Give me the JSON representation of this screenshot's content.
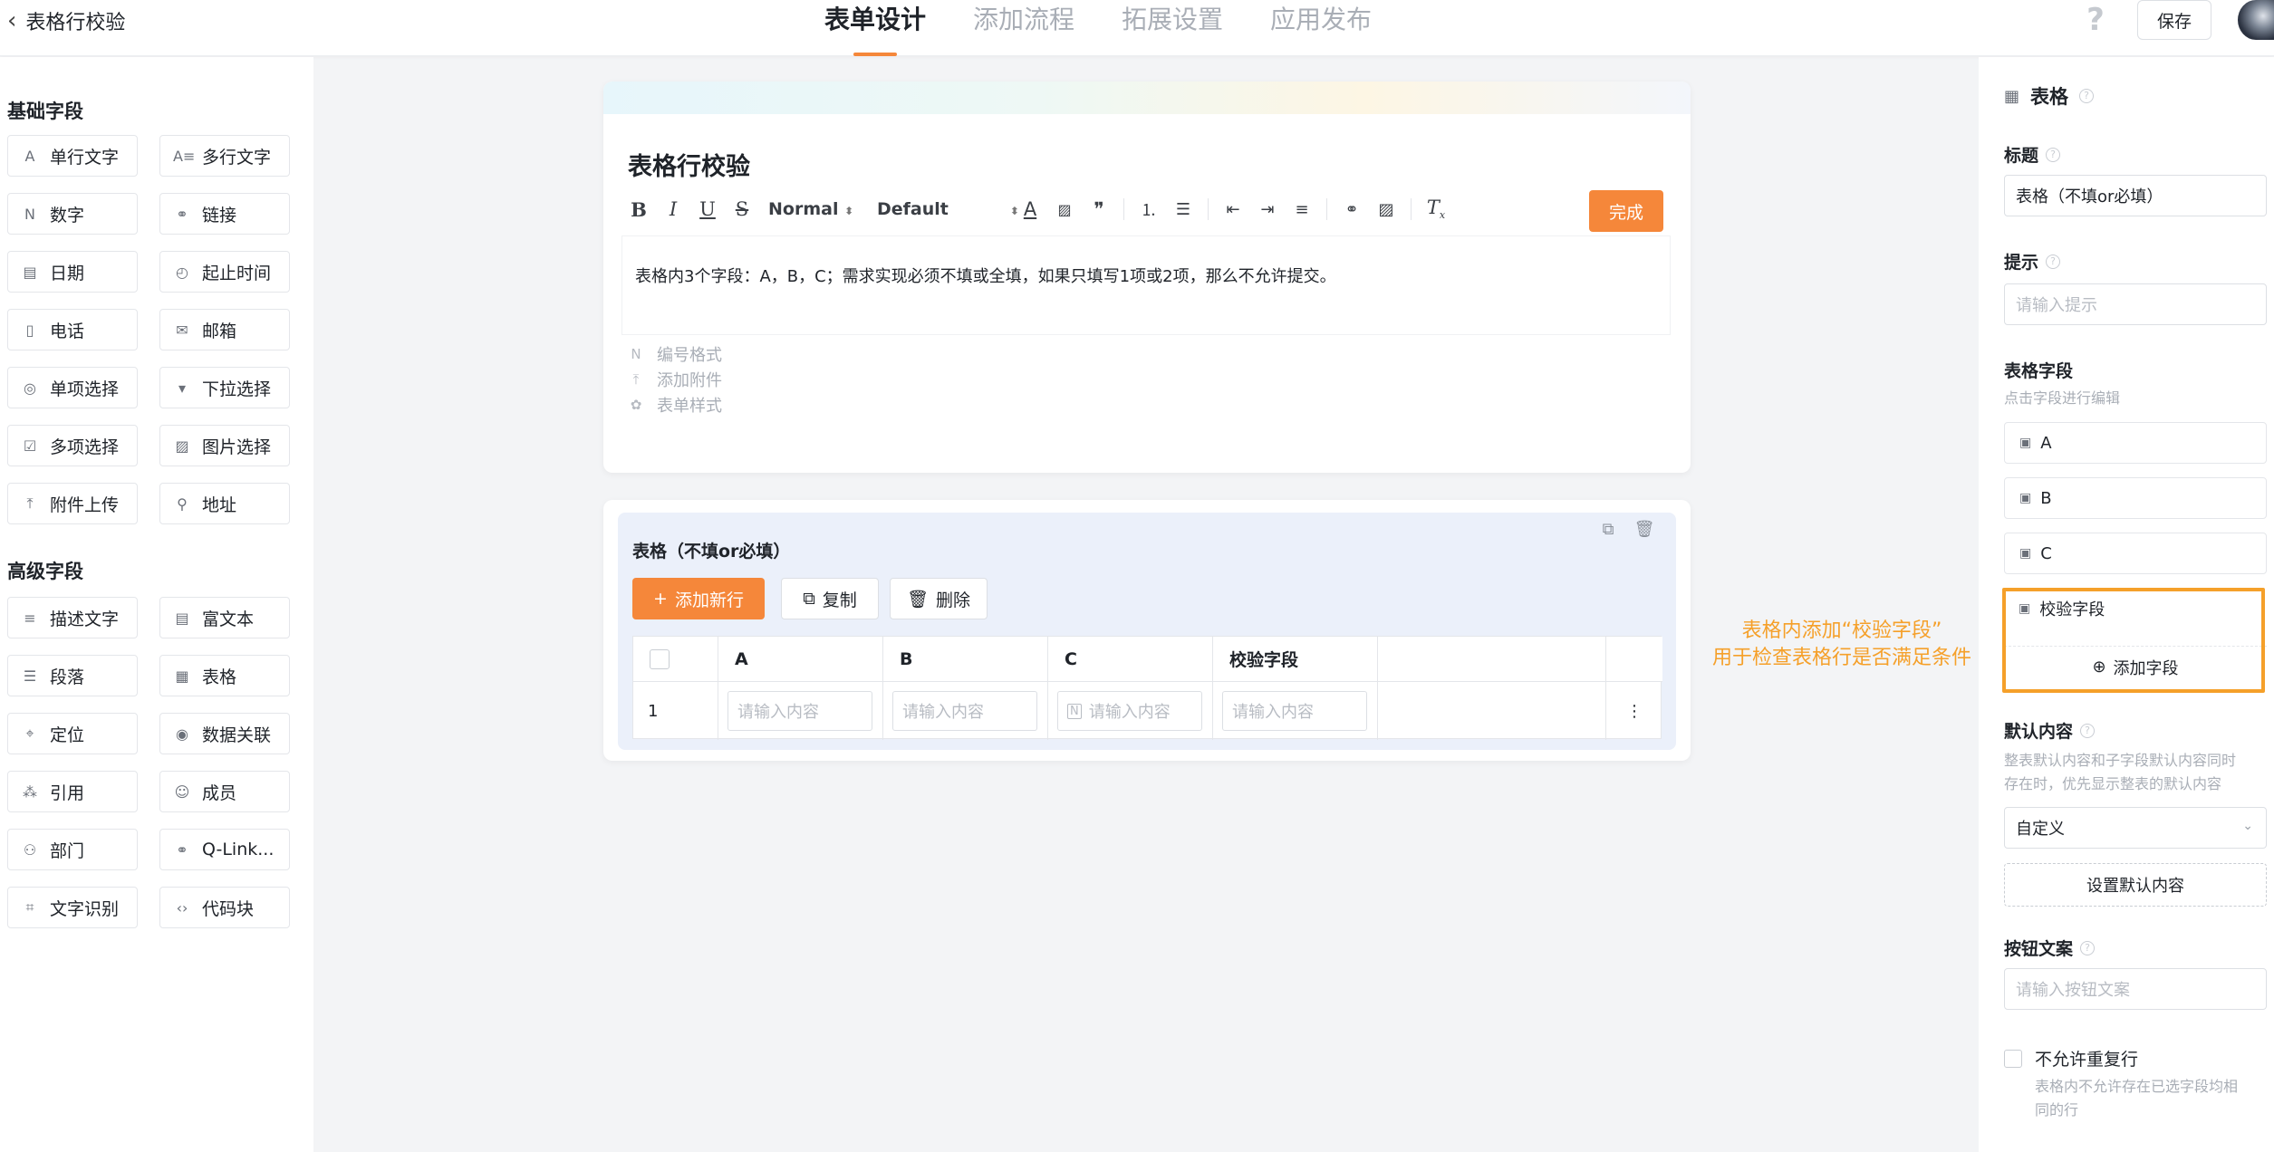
{
  "header": {
    "back_label": "表格行校验",
    "tabs": [
      {
        "label": "表单设计",
        "active": true
      },
      {
        "label": "添加流程",
        "active": false
      },
      {
        "label": "拓展设置",
        "active": false
      },
      {
        "label": "应用发布",
        "active": false
      }
    ],
    "help": "?",
    "save_label": "保存"
  },
  "sidebar": {
    "basic_title": "基础字段",
    "basic": [
      {
        "label": "单行文字",
        "icon": "A"
      },
      {
        "label": "多行文字",
        "icon": "A≡"
      },
      {
        "label": "数字",
        "icon": "N"
      },
      {
        "label": "链接",
        "icon": "⚭"
      },
      {
        "label": "日期",
        "icon": "▤"
      },
      {
        "label": "起止时间",
        "icon": "◴"
      },
      {
        "label": "电话",
        "icon": "▯"
      },
      {
        "label": "邮箱",
        "icon": "✉"
      },
      {
        "label": "单项选择",
        "icon": "◎"
      },
      {
        "label": "下拉选择",
        "icon": "▾"
      },
      {
        "label": "多项选择",
        "icon": "☑"
      },
      {
        "label": "图片选择",
        "icon": "▨"
      },
      {
        "label": "附件上传",
        "icon": "⤒"
      },
      {
        "label": "地址",
        "icon": "⚲"
      }
    ],
    "advanced_title": "高级字段",
    "advanced": [
      {
        "label": "描述文字",
        "icon": "≡"
      },
      {
        "label": "富文本",
        "icon": "▤"
      },
      {
        "label": "段落",
        "icon": "☰"
      },
      {
        "label": "表格",
        "icon": "▦"
      },
      {
        "label": "定位",
        "icon": "⌖"
      },
      {
        "label": "数据关联",
        "icon": "◉"
      },
      {
        "label": "引用",
        "icon": "⁂"
      },
      {
        "label": "成员",
        "icon": "☺"
      },
      {
        "label": "部门",
        "icon": "⚇"
      },
      {
        "label": "Q-Link...",
        "icon": "⚭"
      },
      {
        "label": "文字识别",
        "icon": "⌗"
      },
      {
        "label": "代码块",
        "icon": "‹›"
      }
    ]
  },
  "form": {
    "title": "表格行校验",
    "toolbar": {
      "bold": "B",
      "italic": "I",
      "underline": "U",
      "strike": "S",
      "heading": "Normal",
      "font": "Default",
      "done_label": "完成"
    },
    "description": "表格内3个字段：A，B，C；需求实现必须不填或全填，如果只填写1项或2项，那么不允许提交。",
    "options": [
      "编号格式",
      "添加附件",
      "表单样式"
    ]
  },
  "table_widget": {
    "title": "表格（不填or必填）",
    "add_row_label": "添加新行",
    "copy_label": "复制",
    "delete_label": "删除",
    "columns": [
      "A",
      "B",
      "C",
      "校验字段"
    ],
    "rows": [
      {
        "index": "1"
      }
    ],
    "cell_placeholder": "请输入内容",
    "more_icon": "⋮"
  },
  "annotation": {
    "line1": "表格内添加“校验字段”",
    "line2": "用于检查表格行是否满足条件",
    "color": "#f5a02a"
  },
  "panel": {
    "title": "表格",
    "title_label": "标题",
    "title_value": "表格（不填or必填）",
    "hint_label": "提示",
    "hint_placeholder": "请输入提示",
    "fields_label": "表格字段",
    "fields_hint": "点击字段进行编辑",
    "fields": [
      "A",
      "B",
      "C",
      "校验字段"
    ],
    "add_field_label": "添加字段",
    "default_label": "默认内容",
    "default_hint_1": "整表默认内容和子字段默认内容同时",
    "default_hint_2": "存在时，优先显示整表的默认内容",
    "default_select": "自定义",
    "set_default_label": "设置默认内容",
    "button_text_label": "按钮文案",
    "button_text_placeholder": "请输入按钮文案",
    "no_dup_label": "不允许重复行",
    "no_dup_hint_1": "表格内不允许存在已选字段均相",
    "no_dup_hint_2": "同的行"
  },
  "colors": {
    "accent": "#f5873a",
    "annotation": "#f5a02a"
  }
}
